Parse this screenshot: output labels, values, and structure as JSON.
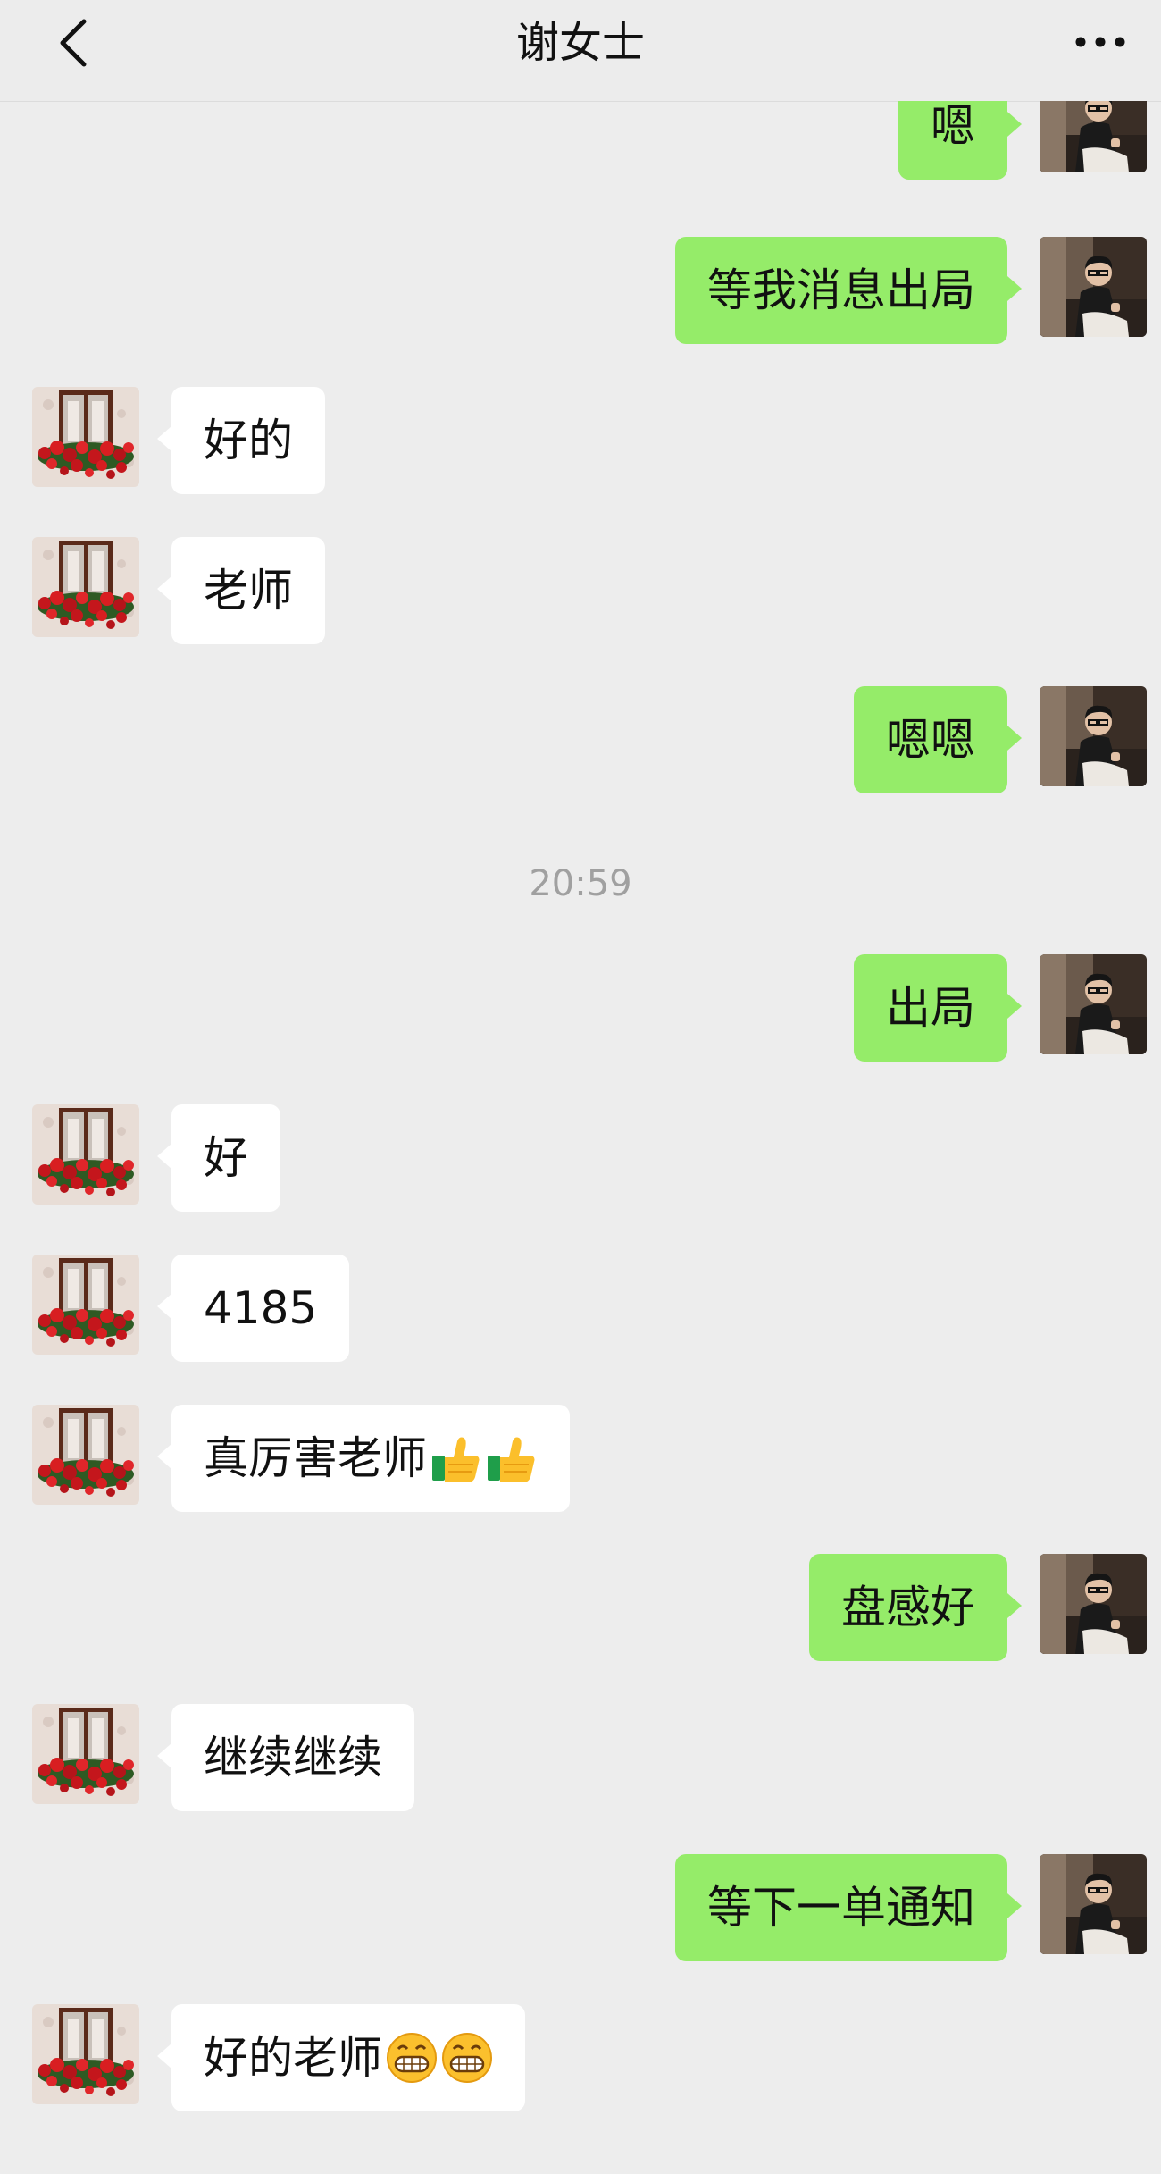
{
  "header": {
    "title": "谢女士",
    "back_icon": "chevron-left-icon",
    "more_icon": "ellipsis-icon"
  },
  "colors": {
    "background": "#ededed",
    "outgoing_bubble": "#95ec69",
    "incoming_bubble": "#ffffff",
    "timestamp": "#a0a0a0"
  },
  "messages": {
    "m1": {
      "side": "out",
      "text": "嗯"
    },
    "m2": {
      "side": "out",
      "text": "等我消息出局"
    },
    "m3": {
      "side": "in",
      "text": "好的"
    },
    "m4": {
      "side": "in",
      "text": "老师"
    },
    "m5": {
      "side": "out",
      "text": "嗯嗯"
    },
    "time1": "20:59",
    "m6": {
      "side": "out",
      "text": "出局"
    },
    "m7": {
      "side": "in",
      "text": "好"
    },
    "m8": {
      "side": "in",
      "text": "4185"
    },
    "m9": {
      "side": "in",
      "text": "真厉害老师",
      "emojis": [
        "thumbs-up-icon",
        "thumbs-up-icon"
      ]
    },
    "m10": {
      "side": "out",
      "text": "盘感好"
    },
    "m11": {
      "side": "in",
      "text": "继续继续"
    },
    "m12": {
      "side": "out",
      "text": "等下一单通知"
    },
    "m13": {
      "side": "in",
      "text": "好的老师",
      "emojis": [
        "grinning-face-icon",
        "grinning-face-icon"
      ]
    }
  }
}
